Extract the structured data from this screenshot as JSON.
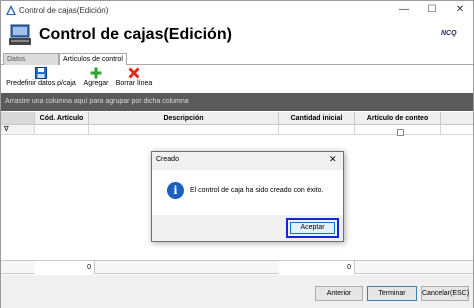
{
  "window": {
    "title": "Control de cajas(Edición)",
    "minimize": "—",
    "maximize": "☐",
    "close": "✕"
  },
  "header": {
    "title": "Control de cajas(Edición)",
    "brand": "NCQ"
  },
  "tabs": [
    {
      "label": "Datos generales"
    },
    {
      "label": "Artículos de control"
    }
  ],
  "toolbar": {
    "items": [
      {
        "label": "Predefinir datos p/caja",
        "icon": "floppy-save-icon"
      },
      {
        "label": "Agregar",
        "icon": "plus-icon"
      },
      {
        "label": "Borrar línea",
        "icon": "red-x-icon"
      }
    ]
  },
  "grid": {
    "group_hint": "Arrastre una columna aquí para agrupar por dicha columna",
    "columns": [
      "Cód. Artículo",
      "Descripción",
      "Cantidad inicial",
      "Artículo de conteo"
    ],
    "filter_symbol": "∇",
    "totals": [
      "0",
      "0"
    ]
  },
  "buttons": {
    "prev": "Anterior",
    "finish": "Terminar",
    "cancel": "Cancelar(ESC)"
  },
  "dialog": {
    "title": "Creado",
    "close": "✕",
    "message": "El control de caja ha sido creado con éxito.",
    "ok": "Aceptar"
  },
  "colors": {
    "accent": "#1b5fbf",
    "focus_outline": "#1028d8",
    "group_panel": "#5a5a5a"
  }
}
